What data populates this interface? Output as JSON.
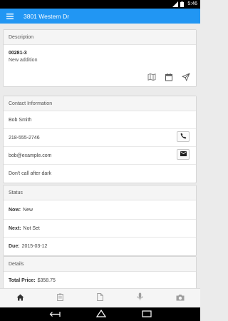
{
  "status_bar": {
    "time": "5:46"
  },
  "app_bar": {
    "title": "3801 Western Dr"
  },
  "description": {
    "header": "Description",
    "id": "00281-3",
    "text": "New addition"
  },
  "contact": {
    "header": "Contact Information",
    "name": "Bob Smith",
    "phone": "218-555-2746",
    "email": "bob@example.com",
    "note": "Don't call after dark"
  },
  "status": {
    "header": "Status",
    "now_label": "Now:",
    "now_value": "New",
    "next_label": "Next:",
    "next_value": "Not Set",
    "due_label": "Due:",
    "due_value": "2015-03-12"
  },
  "details": {
    "header": "Details",
    "total_label": "Total Price:",
    "total_value": "$358.75"
  },
  "tabs": [
    {
      "icon": "home-icon",
      "active": true
    },
    {
      "icon": "clipboard-icon",
      "active": false
    },
    {
      "icon": "document-icon",
      "active": false
    },
    {
      "icon": "microphone-icon",
      "active": false
    },
    {
      "icon": "camera-icon",
      "active": false
    }
  ],
  "colors": {
    "app_bar": "#2196f3",
    "active_tab_icon": "#333333",
    "inactive_tab_icon": "#9e9e9e"
  }
}
